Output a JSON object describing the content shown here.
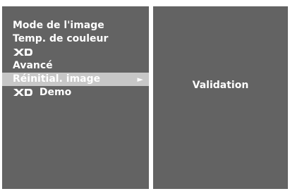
{
  "menu": {
    "items": [
      {
        "label": "Mode de l'image"
      },
      {
        "label": "Temp. de couleur"
      },
      {
        "logo": "XD"
      },
      {
        "label": "Avancé"
      },
      {
        "label": "Réinitial. image",
        "selected": true,
        "arrow": "►"
      },
      {
        "logo": "XD",
        "label": "Demo"
      }
    ]
  },
  "submenu": {
    "label": "Validation"
  },
  "colors": {
    "panel": "#636363",
    "highlight": "#c7c7c7",
    "text": "#ffffff",
    "background": "#ffffff"
  }
}
